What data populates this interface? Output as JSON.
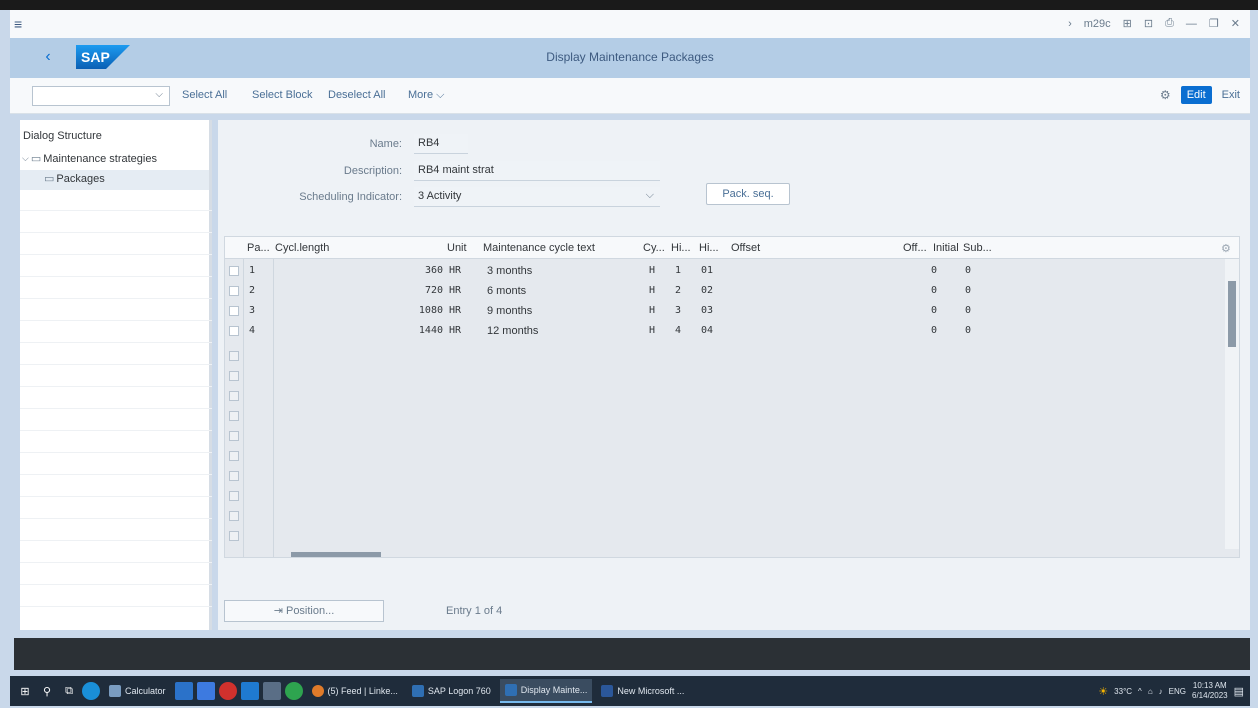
{
  "window": {
    "controls": [
      "›",
      "m29c",
      "⊞",
      "⊡",
      "⎙",
      "—",
      "❐",
      "✕"
    ]
  },
  "shell": {
    "logo": "SAP",
    "title": "Display Maintenance Packages"
  },
  "toolbar": {
    "select_all": "Select All",
    "select_block": "Select Block",
    "deselect_all": "Deselect All",
    "more": "More ⌵",
    "edit": "Edit",
    "exit": "Exit"
  },
  "dialog_structure": {
    "title": "Dialog Structure",
    "items": [
      {
        "label": "Maintenance strategies"
      },
      {
        "label": "Packages"
      }
    ]
  },
  "form": {
    "name_label": "Name:",
    "name_value": "RB4",
    "description_label": "Description:",
    "description_value": "RB4 maint strat",
    "scheduling_label": "Scheduling Indicator:",
    "scheduling_value": "3 Activity",
    "pack_seq": "Pack. seq."
  },
  "table": {
    "columns": [
      "Pa...",
      "Cycl.length",
      "Unit",
      "Maintenance cycle text",
      "Cy...",
      "Hi...",
      "Hi...",
      "Offset",
      "Off...",
      "Initial",
      "Sub..."
    ],
    "rows": [
      {
        "pa": "1",
        "length": "360",
        "unit": "HR",
        "text": "3 months",
        "cy": "H",
        "hi1": "1",
        "hi2": "01",
        "off": "0",
        "initial": "0"
      },
      {
        "pa": "2",
        "length": "720",
        "unit": "HR",
        "text": "6 monts",
        "cy": "H",
        "hi1": "2",
        "hi2": "02",
        "off": "0",
        "initial": "0"
      },
      {
        "pa": "3",
        "length": "1080",
        "unit": "HR",
        "text": "9 months",
        "cy": "H",
        "hi1": "3",
        "hi2": "03",
        "off": "0",
        "initial": "0"
      },
      {
        "pa": "4",
        "length": "1440",
        "unit": "HR",
        "text": "12 months",
        "cy": "H",
        "hi1": "4",
        "hi2": "04",
        "off": "0",
        "initial": "0"
      }
    ]
  },
  "footer": {
    "position_button": "⇥ Position...",
    "entry_text": "Entry 1 of 4"
  },
  "taskbar": {
    "tasks": [
      {
        "label": "Calculator",
        "color": "#7a9cc0"
      },
      {
        "label": "(5) Feed | Linke...",
        "color": "#e07b2a"
      },
      {
        "label": "SAP Logon 760",
        "color": "#2f6fb3"
      },
      {
        "label": "Display Mainte...",
        "color": "#2f6fb3",
        "active": true
      },
      {
        "label": "New Microsoft ...",
        "color": "#2b579a"
      }
    ],
    "weather": "33°C",
    "lang": "ENG",
    "time": "10:13 AM",
    "date": "6/14/2023"
  }
}
